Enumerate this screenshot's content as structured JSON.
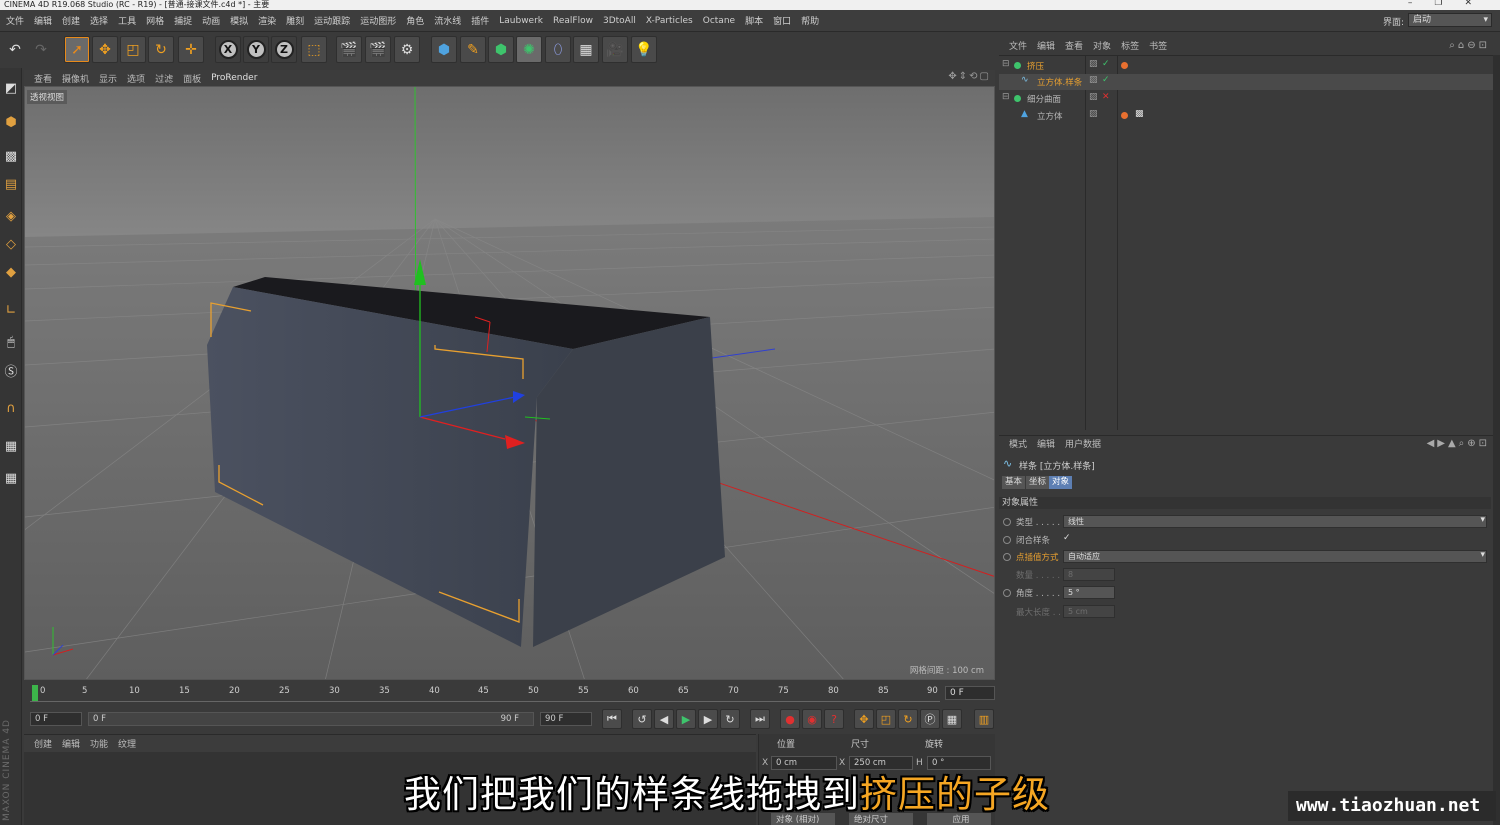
{
  "window": {
    "title": "CINEMA 4D R19.068 Studio (RC - R19) - [普通-接课文件.c4d *] - 主要",
    "controls": [
      "–",
      "❐",
      "✕"
    ]
  },
  "menubar": {
    "items": [
      "文件",
      "编辑",
      "创建",
      "选择",
      "工具",
      "网格",
      "捕捉",
      "动画",
      "模拟",
      "渲染",
      "雕刻",
      "运动跟踪",
      "运动图形",
      "角色",
      "流水线",
      "插件",
      "Laubwerk",
      "RealFlow",
      "3DtoAll",
      "X-Particles",
      "Octane",
      "脚本",
      "窗口",
      "帮助"
    ],
    "layout_label": "界面:",
    "layout_value": "启动"
  },
  "viewport": {
    "menu": [
      "查看",
      "摄像机",
      "显示",
      "选项",
      "过滤",
      "面板",
      "ProRender"
    ],
    "view_name": "透视视图",
    "grid_info": "网格间距 : 100 cm"
  },
  "timeline": {
    "ticks": [
      "0",
      "5",
      "10",
      "15",
      "20",
      "25",
      "30",
      "35",
      "40",
      "45",
      "50",
      "55",
      "60",
      "65",
      "70",
      "75",
      "80",
      "85",
      "90"
    ],
    "end_frame": "0 F",
    "current_frame": "0 F",
    "range_start": "0 F",
    "range_end_inner": "90 F",
    "range_end": "90 F"
  },
  "material_manager": {
    "menu": [
      "创建",
      "编辑",
      "功能",
      "纹理"
    ]
  },
  "coordinates": {
    "headers": [
      "位置",
      "尺寸",
      "旋转"
    ],
    "x_pos": "0 cm",
    "x_size": "250 cm",
    "h_rot": "0 °",
    "x_label": "X",
    "x2_label": "X",
    "h_label": "H",
    "mode_left": "对象 (相对)",
    "mode_right": "绝对尺寸",
    "apply": "应用"
  },
  "object_manager": {
    "menu": [
      "文件",
      "编辑",
      "查看",
      "对象",
      "标签",
      "书签"
    ],
    "objects": [
      {
        "name": "挤压",
        "selected": true
      },
      {
        "name": "立方体.样条",
        "selected": true
      },
      {
        "name": "细分曲面",
        "selected": false
      },
      {
        "name": "立方体",
        "selected": false
      }
    ]
  },
  "attributes": {
    "menu": [
      "模式",
      "编辑",
      "用户数据"
    ],
    "title": "样条 [立方体.样条]",
    "tabs": [
      "基本",
      "坐标",
      "对象"
    ],
    "section": "对象属性",
    "rows": [
      {
        "label": "类型 . . . . .",
        "value": "线性",
        "disabled": false
      },
      {
        "label": "闭合样条",
        "value": "✓",
        "disabled": false
      },
      {
        "label": "点插值方式",
        "value": "自动适应",
        "disabled": false,
        "highlight": true
      },
      {
        "label": "数量 . . . . .",
        "value": "8",
        "disabled": true
      },
      {
        "label": "角度 . . . . .",
        "value": "5 °",
        "disabled": false
      },
      {
        "label": "最大长度 . .",
        "value": "5 cm",
        "disabled": true
      }
    ]
  },
  "subtitle": {
    "part1": "我们把我们的样条线拖拽到",
    "part2": "挤压的子级"
  },
  "watermark": "www.tiaozhuan.net",
  "brand": "MAXON CINEMA 4D",
  "colors": {
    "accent_orange": "#e8a030",
    "selection_blue": "#5d7fb3",
    "axis_red": "#e02020",
    "axis_green": "#20c020",
    "axis_blue": "#2040e0"
  }
}
